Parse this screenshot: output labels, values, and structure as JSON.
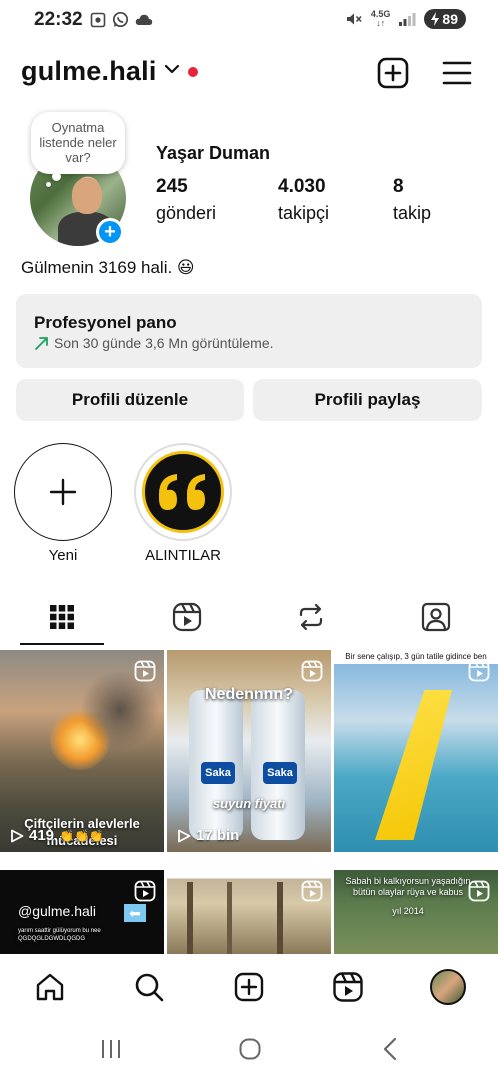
{
  "status_bar": {
    "time": "22:32",
    "network": "4.5G",
    "battery": "89",
    "icons": [
      "screenshot-icon",
      "whatsapp-icon",
      "cloud-icon",
      "mute-icon",
      "signal-icon",
      "battery-icon"
    ]
  },
  "header": {
    "username": "gulme.hali",
    "icons": [
      "chevron-down-icon",
      "create-post-icon",
      "hamburger-menu-icon"
    ],
    "live_dot_color": "#e7233a"
  },
  "profile": {
    "note": "Oynatma listende neler var?",
    "display_name": "Yaşar Duman",
    "add_story_symbol": "+",
    "stats": [
      {
        "value": "245",
        "label": "gönderi"
      },
      {
        "value": "4.030",
        "label": "takipçi"
      },
      {
        "value": "8",
        "label": "takip"
      }
    ],
    "bio": "Gülmenin 3169 hali. 😃"
  },
  "dashboard": {
    "title": "Profesyonel pano",
    "subtitle": "Son 30 günde 3,6 Mn görüntüleme.",
    "accent_color": "#1aa260"
  },
  "actions": {
    "edit_profile": "Profili düzenle",
    "share_profile": "Profili paylaş"
  },
  "highlights": [
    {
      "label": "Yeni",
      "icon": "plus-icon"
    },
    {
      "label": "ALINTILAR",
      "icon": "quote-icon"
    }
  ],
  "tabs": [
    {
      "name": "posts-grid",
      "icon": "grid-icon",
      "active": true
    },
    {
      "name": "reels",
      "icon": "reels-icon",
      "active": false
    },
    {
      "name": "reposts",
      "icon": "repost-icon",
      "active": false
    },
    {
      "name": "tagged",
      "icon": "tagged-person-icon",
      "active": false
    }
  ],
  "grid_posts": [
    {
      "caption": "Çiftçilerin alevlerle mücadelesi",
      "views": "419",
      "emoji": "👏👏👏"
    },
    {
      "caption": "Nedennnn?",
      "views": "17 bin",
      "product_text": "Saka",
      "sub_caption": "suyun fiyatı"
    },
    {
      "caption": "Bir sene çalışıp, 3 gün tatile gidince ben",
      "views": ""
    },
    {
      "caption": "@gulme.hali",
      "small_text": "yarım saattir gülüyorum bu nee",
      "tiny_text": "QGDQGLDGWDLQGDG"
    },
    {
      "caption": ""
    },
    {
      "caption": "Sabah bi kalkıyorsun yaşadığın bütün olaylar rüya ve kabus",
      "small_text": "yıl 2014"
    }
  ],
  "bottom_nav": [
    "home-icon",
    "search-icon",
    "create-icon",
    "reels-icon",
    "profile-avatar"
  ],
  "system_nav": [
    "recents-icon",
    "home-circle-icon",
    "back-icon"
  ]
}
